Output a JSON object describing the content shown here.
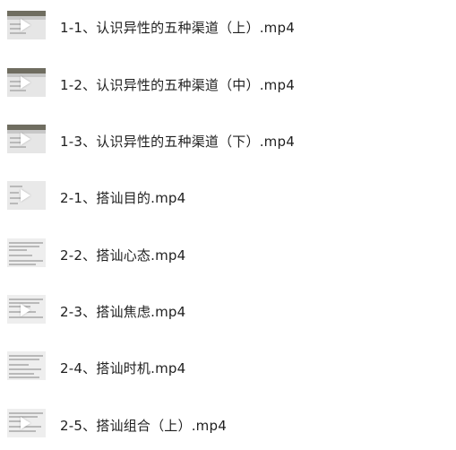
{
  "files": [
    {
      "name": "1-1、认识异性的五种渠道（上）.mp4",
      "thumb": "dark"
    },
    {
      "name": "1-2、认识异性的五种渠道（中）.mp4",
      "thumb": "dark"
    },
    {
      "name": "1-3、认识异性的五种渠道（下）.mp4",
      "thumb": "dark"
    },
    {
      "name": "2-1、搭讪目的.mp4",
      "thumb": "light"
    },
    {
      "name": "2-2、搭讪心态.mp4",
      "thumb": "text"
    },
    {
      "name": "2-3、搭讪焦虑.mp4",
      "thumb": "text"
    },
    {
      "name": "2-4、搭讪时机.mp4",
      "thumb": "text"
    },
    {
      "name": "2-5、搭讪组合（上）.mp4",
      "thumb": "text"
    }
  ],
  "icons": {
    "thumbnail": "video-thumbnail-icon",
    "play": "play-icon"
  }
}
